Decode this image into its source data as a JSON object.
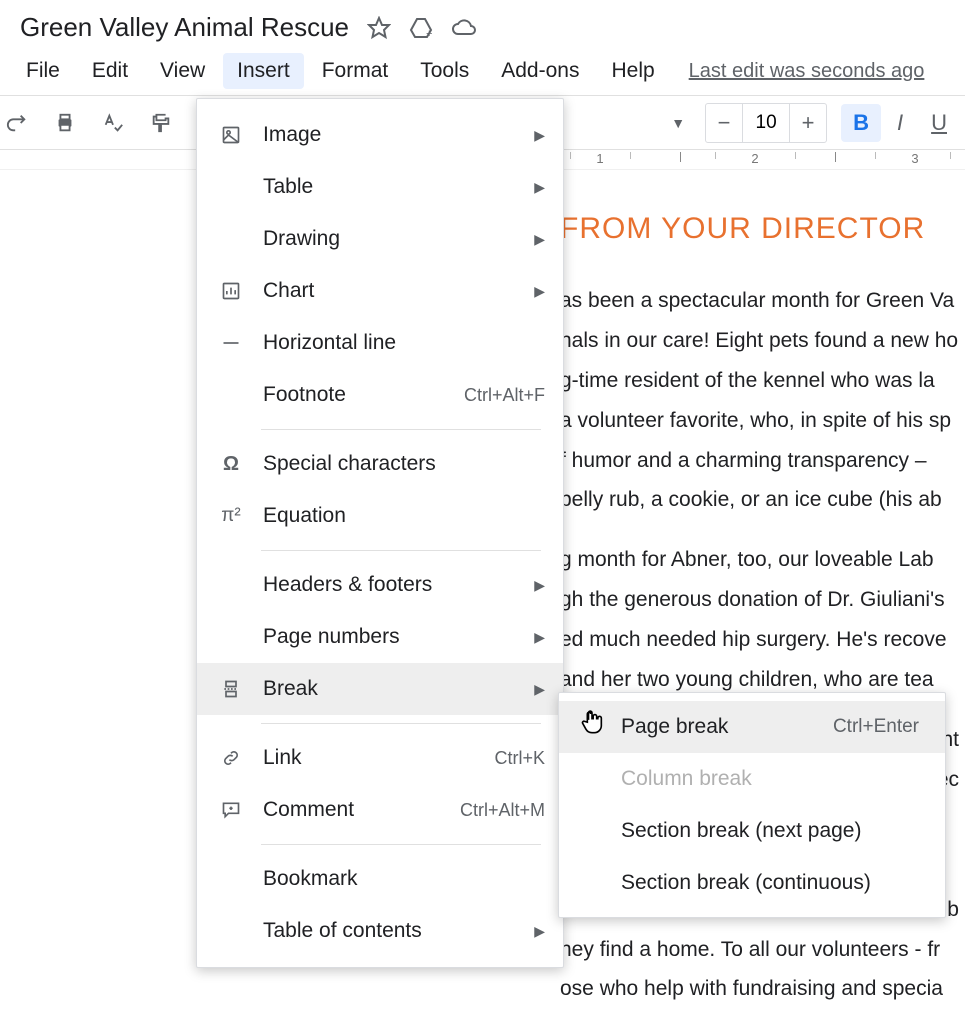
{
  "header": {
    "doc_title": "Green Valley Animal Rescue"
  },
  "menubar": {
    "file": "File",
    "edit": "Edit",
    "view": "View",
    "insert": "Insert",
    "format": "Format",
    "tools": "Tools",
    "addons": "Add-ons",
    "help": "Help",
    "last_edit": "Last edit was seconds ago"
  },
  "toolbar": {
    "font_size": "10",
    "bold": "B",
    "italic": "I",
    "underline": "U"
  },
  "ruler": {
    "t1": "1",
    "t2": "2",
    "t3": "3"
  },
  "document": {
    "heading": "FROM YOUR DIRECTOR",
    "p1": "as been a spectacular month for Green Va",
    "p1b": "nals in our care! Eight pets found a new ho",
    "p1c": "g-time resident of the kennel who was la",
    "p1d": "a volunteer favorite, who, in spite of his sp",
    "p1e": "f humor and a charming transparency – ",
    "p1f": " belly rub, a cookie, or an ice cube (his ab",
    "p2": "g month for Abner, too, our loveable Lab ",
    "p2b": "gh the generous donation of Dr. Giuliani's",
    "p2c": "ed much needed hip surgery. He's recove",
    "p2d": " and her two young children, who are tea",
    "p3a": "nt",
    "p3b": "ec",
    "p4a": "sib",
    "p4b": "hey find a home. To all our volunteers - fr",
    "p4c": "ose who help with fundraising and specia"
  },
  "insert_menu": {
    "image": "Image",
    "table": "Table",
    "drawing": "Drawing",
    "chart": "Chart",
    "hline": "Horizontal line",
    "footnote": "Footnote",
    "footnote_sc": "Ctrl+Alt+F",
    "special": "Special characters",
    "equation": "Equation",
    "headers": "Headers & footers",
    "pagenum": "Page numbers",
    "break": "Break",
    "link": "Link",
    "link_sc": "Ctrl+K",
    "comment": "Comment",
    "comment_sc": "Ctrl+Alt+M",
    "bookmark": "Bookmark",
    "toc": "Table of contents"
  },
  "break_submenu": {
    "page": "Page break",
    "page_sc": "Ctrl+Enter",
    "column": "Column break",
    "section_next": "Section break (next page)",
    "section_cont": "Section break (continuous)"
  }
}
